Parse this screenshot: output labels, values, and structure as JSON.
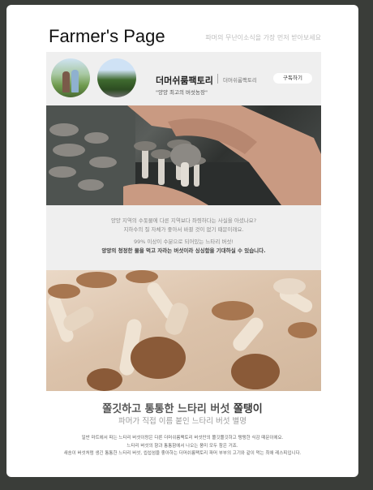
{
  "header": {
    "title": "Farmer's Page",
    "subtitle": "파머의 무난이소식을 가장 먼저 받아보세요"
  },
  "profile": {
    "farm_name": "더머쉬룸팩토리",
    "farm_tag": "더머쉬룸팩토리",
    "description": "\"양양 최고의 버섯농장\"",
    "subscribe_label": "구독하기"
  },
  "intro": {
    "line1": "양양 지역의 수돗물에 다른 지역보다 좌령하다는 사실을 아셨나요?",
    "line2": "지하수의 질 자체가 좋아서 바뀔 것이 없기 때문이래요.",
    "line3": "99% 이상이 수분으로 되어있는 느타리 버섯!",
    "line4": "양양의 청정한 물을 먹고 자라는 버섯이라 싱싱함을 기대하실 수 있습니다."
  },
  "section": {
    "headline_prefix": "쫄깃하고 통통한 느타리 버섯",
    "headline_accent": "쫄탱이",
    "subheadline": "파머가 직접 이름 붙인 느타리 버섯 별명",
    "body": [
      "일반 마트에서 파는 느타리 버섯이랑은 다른 더머쉬룸팩토리 버섯만의 쫄깃쫄깃하고 탱탱한 식감 때문이에요.",
      "느타리 버섯의 향과 통통함에서 나오는 풍미 모두 참은 거죠.",
      "새송이 버섯처럼 생긴 통통한 느타리 버섯, 씹섭섬을 좋아하는 더머쉬룸팩토리 파머 부부의 고기와 같이 먹는 최애 레스피입니다."
    ]
  },
  "colors": {
    "background": "#3a3d39",
    "card": "#ffffff",
    "panel": "#efefef"
  }
}
